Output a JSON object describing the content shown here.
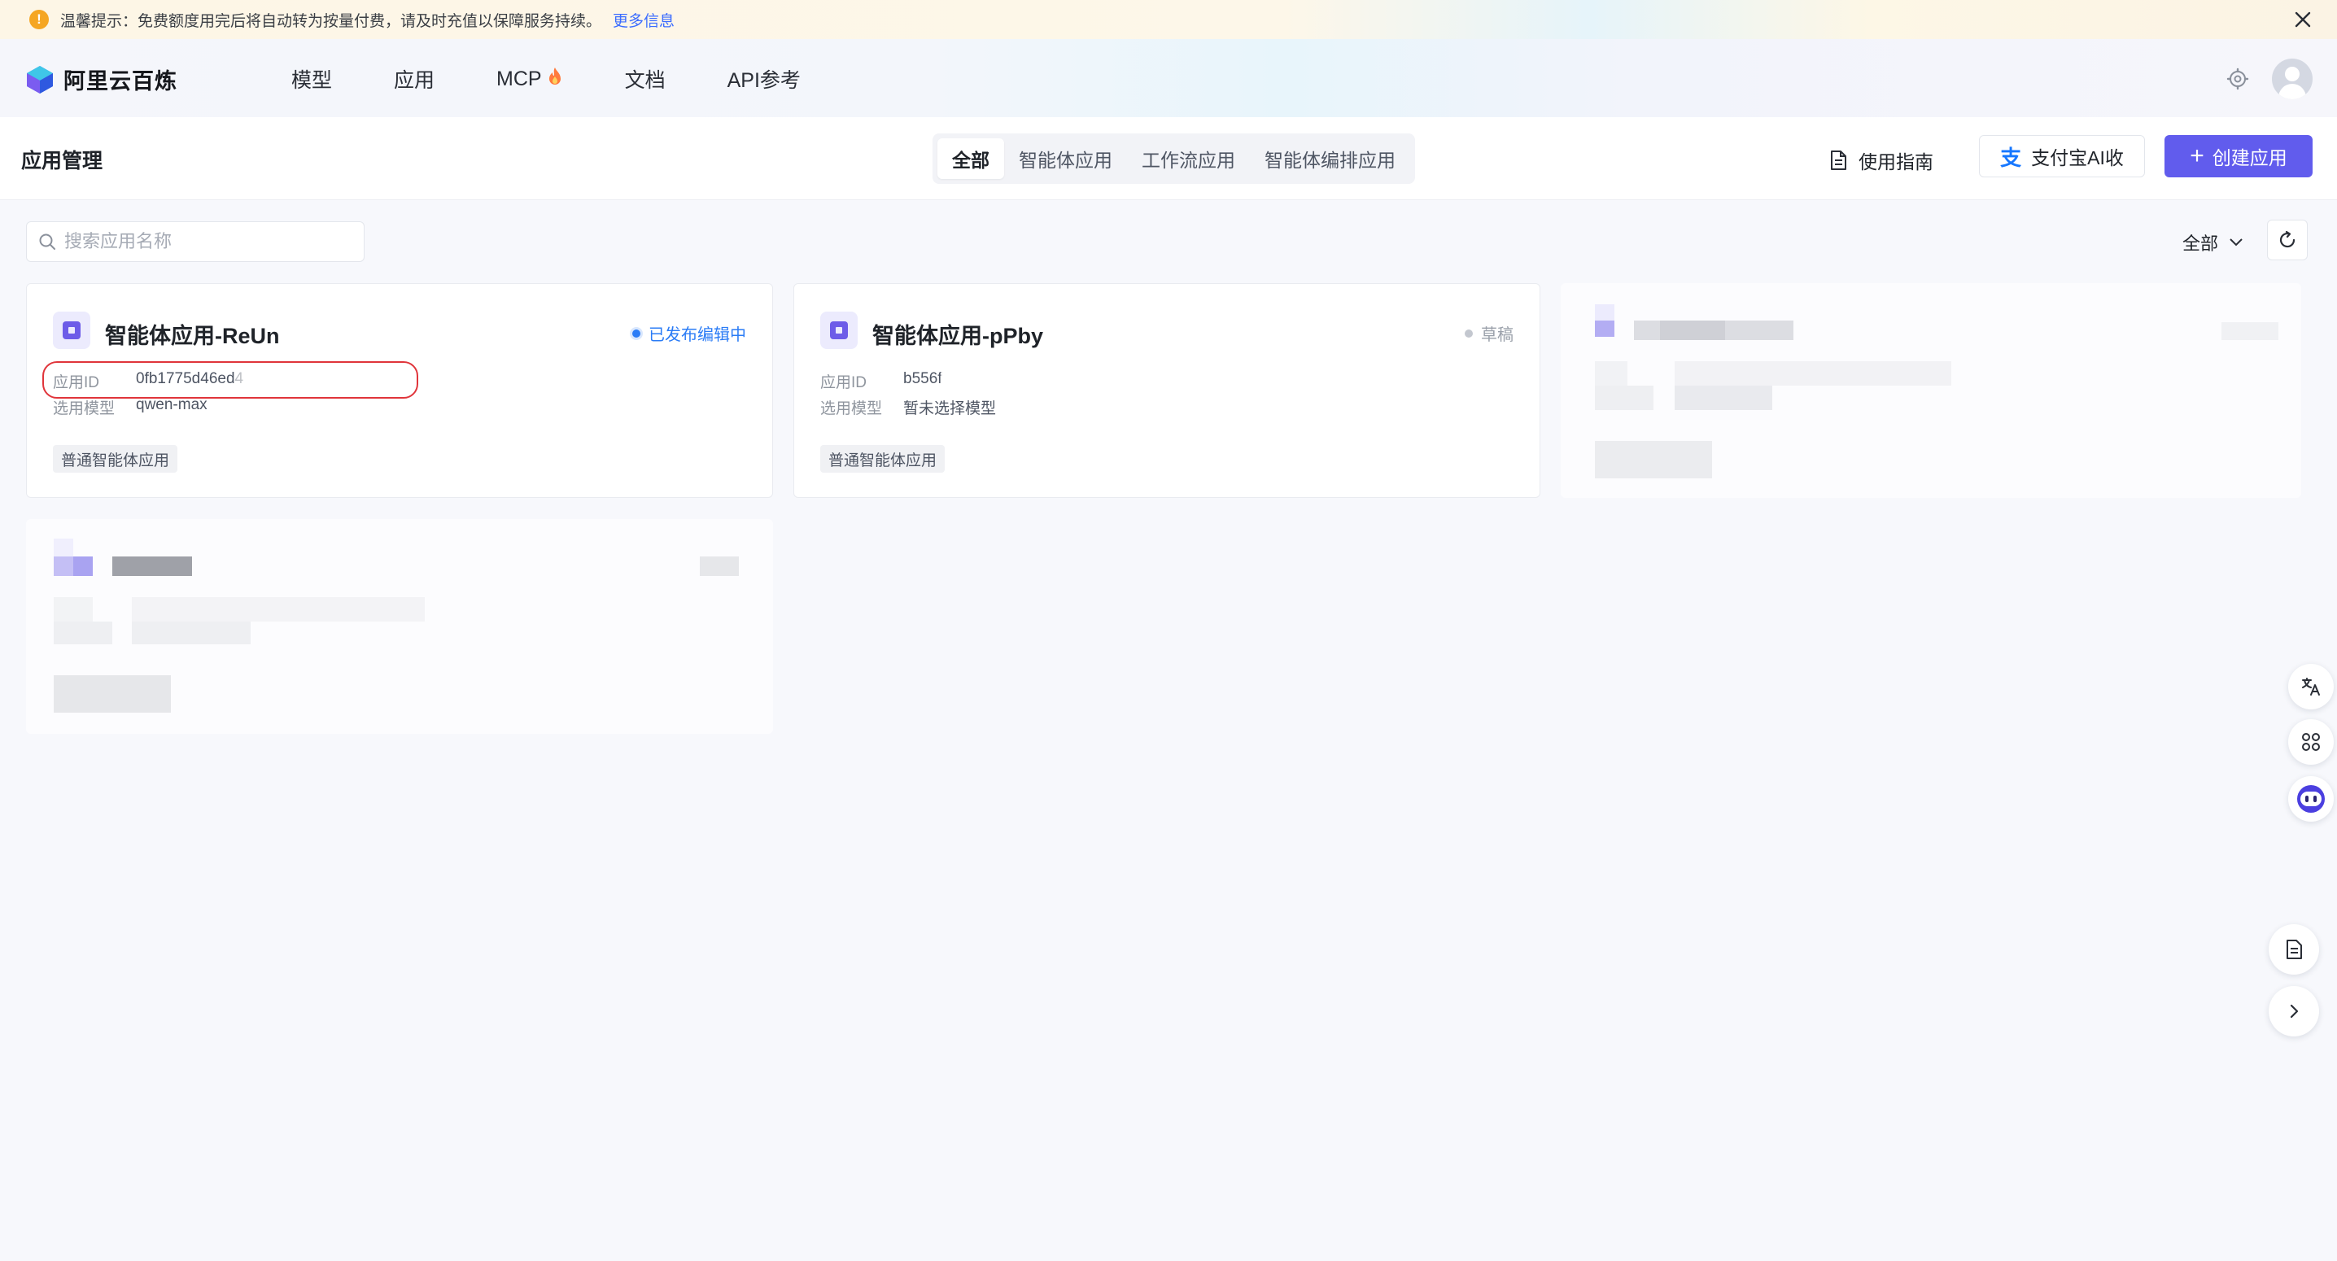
{
  "notice": {
    "text": "温馨提示：免费额度用完后将自动转为按量付费，请及时充值以保障服务持续。",
    "link": "更多信息"
  },
  "brand": {
    "name": "阿里云百炼"
  },
  "nav": {
    "items": [
      {
        "label": "模型"
      },
      {
        "label": "应用"
      },
      {
        "label": "MCP"
      },
      {
        "label": "文档"
      },
      {
        "label": "API参考"
      }
    ]
  },
  "header": {
    "title": "应用管理",
    "tabs": [
      {
        "label": "全部",
        "active": true
      },
      {
        "label": "智能体应用",
        "active": false
      },
      {
        "label": "工作流应用",
        "active": false
      },
      {
        "label": "智能体编排应用",
        "active": false
      }
    ],
    "guide_label": "使用指南",
    "alipay_icon": "支",
    "alipay_label": "支付宝AI收",
    "create_label": "创建应用"
  },
  "search": {
    "placeholder": "搜索应用名称",
    "value": ""
  },
  "filter": {
    "label": "全部"
  },
  "cards": [
    {
      "title": "智能体应用-ReUn",
      "status": "已发布编辑中",
      "status_type": "published",
      "id_label": "应用ID",
      "id_value": "0fb1775d46ed4",
      "model_label": "选用模型",
      "model_value": "qwen-max",
      "tag": "普通智能体应用"
    },
    {
      "title": "智能体应用-pPby",
      "status": "草稿",
      "status_type": "draft",
      "id_label": "应用ID",
      "id_value": "b556f",
      "model_label": "选用模型",
      "model_value": "暂未选择模型",
      "tag": "普通智能体应用"
    }
  ],
  "colors": {
    "accent": "#615ced",
    "link": "#3b6cff",
    "published": "#2b7cf6",
    "highlight_border": "#e0353b",
    "warning": "#f5a623"
  },
  "icons": {
    "notice": "warning-icon",
    "close": "close-icon",
    "settings": "gear-icon",
    "guide": "document-icon",
    "search": "search-icon",
    "filter": "chevron-down-icon",
    "refresh": "refresh-icon",
    "float": [
      "translate-icon",
      "apps-grid-icon",
      "assistant-bot-icon",
      "document-icon",
      "chevron-right-icon"
    ]
  }
}
